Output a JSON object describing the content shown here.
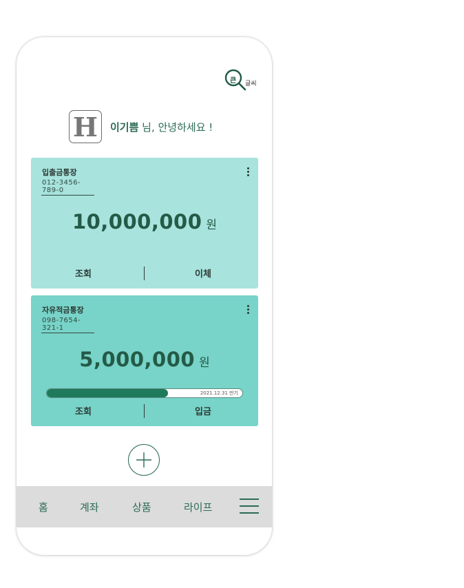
{
  "header": {
    "bigtext_glyph": "큰",
    "bigtext_label": "글씨"
  },
  "greeting": {
    "avatar_letter": "H",
    "name": "이기쁨",
    "message": " 님, 안녕하세요 !"
  },
  "accounts": [
    {
      "name": "입출금통장",
      "number": "012-3456-789-0",
      "amount": "10,000,000",
      "unit": "원",
      "actions": [
        "조회",
        "이체"
      ]
    },
    {
      "name": "자유적금통장",
      "number": "098-7654-321-1",
      "amount": "5,000,000",
      "unit": "원",
      "progress": {
        "fraction": 0.62,
        "label": "2021.12.31 만기"
      },
      "actions": [
        "조회",
        "입금"
      ]
    }
  ],
  "tabbar": {
    "tabs": [
      "홈",
      "계좌",
      "상품",
      "라이프"
    ]
  },
  "colors": {
    "accent": "#2a6a55",
    "card1": "#a8e3dd",
    "card2": "#78d3c8",
    "progress": "#1e7a5a",
    "tabbar": "#dcdcdc"
  }
}
